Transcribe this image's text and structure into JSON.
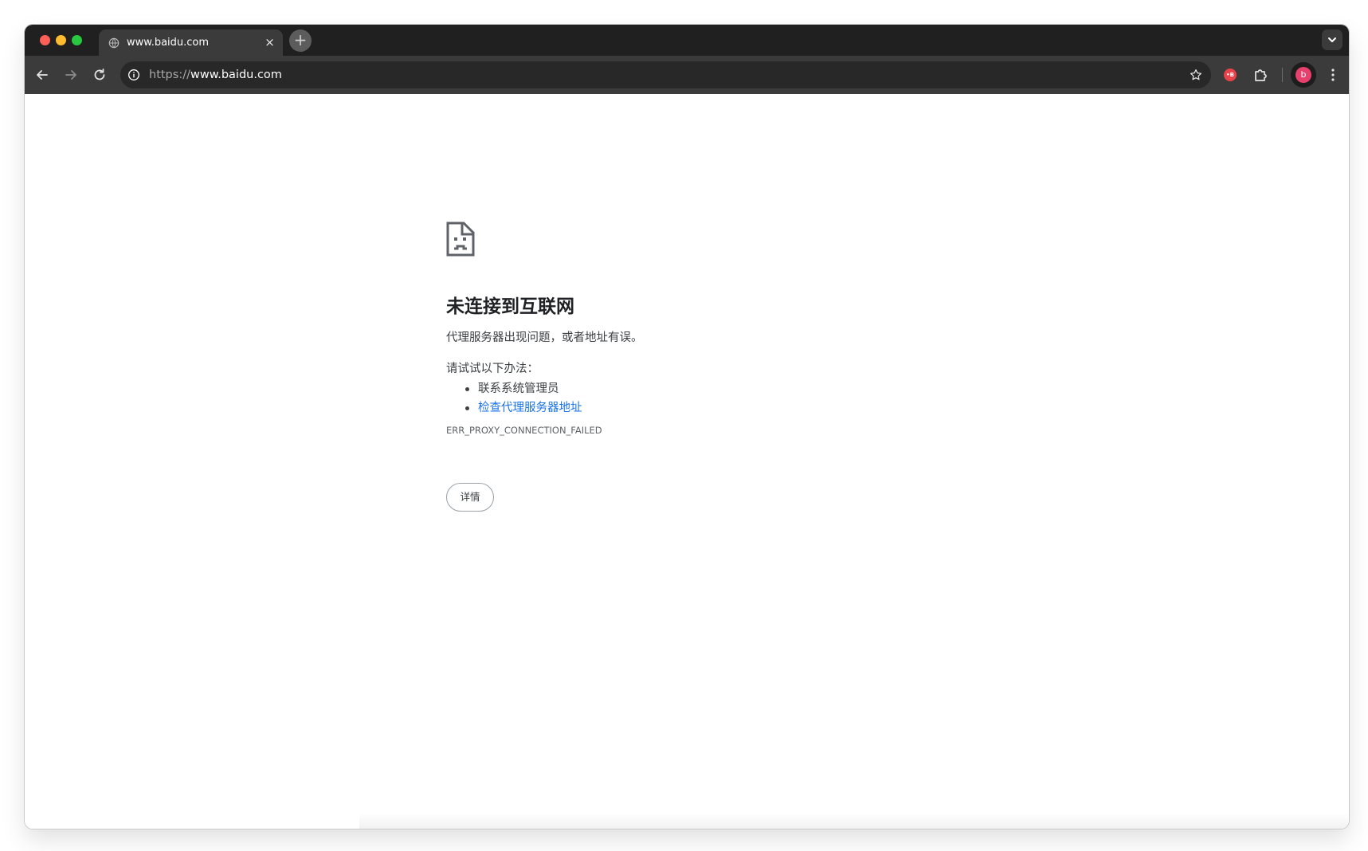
{
  "browser": {
    "tab": {
      "title": "www.baidu.com",
      "close_glyph": "×",
      "favicon": "globe-icon"
    },
    "new_tab_glyph": "+",
    "tab_search_icon": "chevron-down-icon",
    "toolbar": {
      "back_icon": "arrow-left-icon",
      "forward_icon": "arrow-right-icon",
      "reload_icon": "reload-icon",
      "extensions_icon": "puzzle-icon",
      "menu_icon": "kebab-menu-icon"
    },
    "omnibox": {
      "info_icon": "info-icon",
      "url_scheme": "https://",
      "url_host": "www.baidu.com",
      "bookmark_icon": "star-icon"
    },
    "extension_badge": "•B",
    "profile_initial": "b"
  },
  "error_page": {
    "icon": "sad-document-icon",
    "title": "未连接到互联网",
    "description": "代理服务器出现问题，或者地址有误。",
    "try_heading": "请试试以下办法：",
    "suggestions": [
      {
        "text": "联系系统管理员",
        "is_link": false
      },
      {
        "text": "检查代理服务器地址",
        "is_link": true
      }
    ],
    "error_code": "ERR_PROXY_CONNECTION_FAILED",
    "details_button": "详情"
  },
  "colors": {
    "tabstrip_bg": "#202020",
    "toolbar_bg": "#3b3b3b",
    "omnibox_bg": "#282828",
    "link": "#1a73e8",
    "profile_accent": "#e8406d",
    "extension_accent": "#e8424a"
  }
}
